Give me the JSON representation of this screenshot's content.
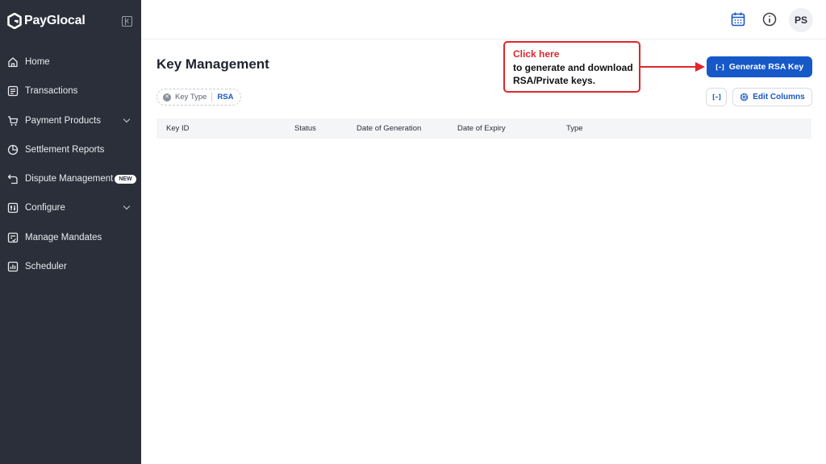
{
  "brand": {
    "name": "PayGlocal"
  },
  "sidebar": {
    "items": [
      {
        "label": "Home",
        "icon": "home-icon"
      },
      {
        "label": "Transactions",
        "icon": "transactions-icon"
      },
      {
        "label": "Payment Products",
        "icon": "cart-icon",
        "expandable": true
      },
      {
        "label": "Settlement Reports",
        "icon": "pie-chart-icon"
      },
      {
        "label": "Dispute Management",
        "icon": "return-icon",
        "badge": "NEW"
      },
      {
        "label": "Configure",
        "icon": "configure-icon",
        "expandable": true
      },
      {
        "label": "Manage Mandates",
        "icon": "mandate-icon"
      },
      {
        "label": "Scheduler",
        "icon": "scheduler-icon"
      }
    ]
  },
  "header": {
    "icons": [
      "calendar-icon",
      "info-icon"
    ],
    "avatar_initials": "PS"
  },
  "main": {
    "title": "Key Management",
    "filter_chip": {
      "key": "Key Type",
      "value": "RSA"
    },
    "generate_button": "Generate RSA Key",
    "edit_columns_button": "Edit Columns",
    "table": {
      "columns": [
        "Key ID",
        "Status",
        "Date of Generation",
        "Date of Expiry",
        "Type"
      ],
      "rows": []
    }
  },
  "annotation": {
    "title": "Click here",
    "line1": "to generate and download",
    "line2": "RSA/Private keys."
  },
  "colors": {
    "sidebar_bg": "#2b2f3a",
    "primary": "#1658c8",
    "annotation": "#e0262b"
  }
}
